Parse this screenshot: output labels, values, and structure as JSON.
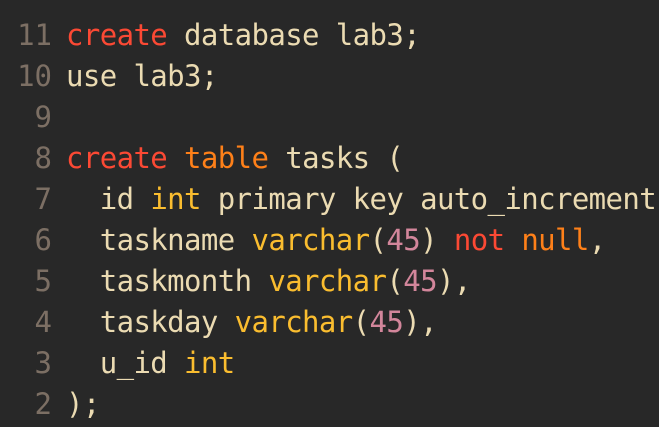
{
  "editor": {
    "lines": [
      {
        "number": "11",
        "tokens": [
          {
            "text": "create",
            "kind": "kw-red"
          },
          {
            "text": " database lab3;",
            "kind": "plain"
          }
        ]
      },
      {
        "number": "10",
        "tokens": [
          {
            "text": "use lab3;",
            "kind": "plain"
          }
        ]
      },
      {
        "number": "9",
        "tokens": []
      },
      {
        "number": "8",
        "tokens": [
          {
            "text": "create",
            "kind": "kw-red"
          },
          {
            "text": " ",
            "kind": "plain"
          },
          {
            "text": "table",
            "kind": "kw-orange"
          },
          {
            "text": " tasks (",
            "kind": "plain"
          }
        ]
      },
      {
        "number": "7",
        "tokens": [
          {
            "text": "  id ",
            "kind": "plain"
          },
          {
            "text": "int",
            "kind": "type"
          },
          {
            "text": " primary key auto_increment,",
            "kind": "plain"
          }
        ]
      },
      {
        "number": "6",
        "tokens": [
          {
            "text": "  taskname ",
            "kind": "plain"
          },
          {
            "text": "varchar",
            "kind": "type"
          },
          {
            "text": "(",
            "kind": "plain"
          },
          {
            "text": "45",
            "kind": "num"
          },
          {
            "text": ") ",
            "kind": "plain"
          },
          {
            "text": "not",
            "kind": "kw-red"
          },
          {
            "text": " ",
            "kind": "plain"
          },
          {
            "text": "null",
            "kind": "kw-orange"
          },
          {
            "text": ",",
            "kind": "plain"
          }
        ]
      },
      {
        "number": "5",
        "tokens": [
          {
            "text": "  taskmonth ",
            "kind": "plain"
          },
          {
            "text": "varchar",
            "kind": "type"
          },
          {
            "text": "(",
            "kind": "plain"
          },
          {
            "text": "45",
            "kind": "num"
          },
          {
            "text": "),",
            "kind": "plain"
          }
        ]
      },
      {
        "number": "4",
        "tokens": [
          {
            "text": "  taskday ",
            "kind": "plain"
          },
          {
            "text": "varchar",
            "kind": "type"
          },
          {
            "text": "(",
            "kind": "plain"
          },
          {
            "text": "45",
            "kind": "num"
          },
          {
            "text": "),",
            "kind": "plain"
          }
        ]
      },
      {
        "number": "3",
        "tokens": [
          {
            "text": "  u_id ",
            "kind": "plain"
          },
          {
            "text": "int",
            "kind": "type"
          }
        ]
      },
      {
        "number": "2",
        "tokens": [
          {
            "text": ");",
            "kind": "plain"
          }
        ]
      }
    ]
  },
  "colors": {
    "background": "#282828",
    "foreground": "#ebdbb2",
    "gutter": "#7c6f64",
    "keyword_red": "#fb4934",
    "keyword_orange": "#fe8019",
    "type_yellow": "#fabd2f",
    "number_purple": "#d3869b"
  }
}
